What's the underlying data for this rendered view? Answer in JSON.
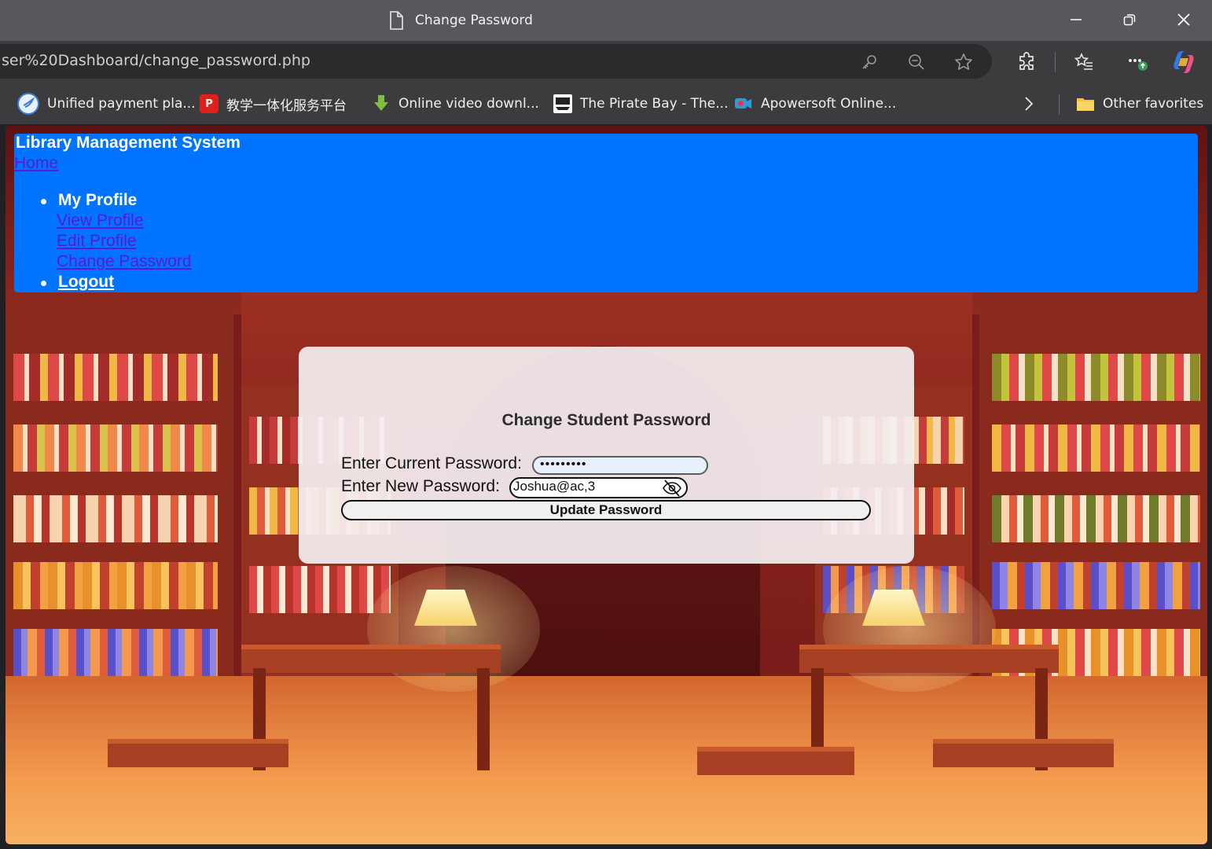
{
  "browser": {
    "tab_title": "Change Password",
    "url": "ser%20Dashboard/change_password.php",
    "favorites": [
      {
        "label": "Unified payment pla...",
        "icon": "globe-icon",
        "color": "#3a7bd5"
      },
      {
        "label": "教学一体化服务平台",
        "icon": "p-logo-icon",
        "color": "#e0201b"
      },
      {
        "label": "Online video downl...",
        "icon": "download-arrow-icon",
        "color": "#7bc043"
      },
      {
        "label": "The Pirate Bay - The...",
        "icon": "pirate-ship-icon",
        "color": "#ffffff"
      },
      {
        "label": "Apowersoft Online...",
        "icon": "camera-icon",
        "color": "#e63946"
      }
    ],
    "other_favorites": "Other favorites"
  },
  "navbar": {
    "brand": "Library Management System",
    "home": "Home",
    "profile_menu": "My Profile",
    "view_profile": "View Profile",
    "edit_profile": "Edit Profile",
    "change_password": "Change Password",
    "logout": "Logout",
    "bg_color": "#0073ff"
  },
  "form": {
    "title": "Change Student Password",
    "current_label": "Enter Current Password:",
    "current_value": "•••••••••",
    "new_label": "Enter New Password:",
    "new_value": "Joshua@ac,3",
    "submit": "Update Password"
  }
}
